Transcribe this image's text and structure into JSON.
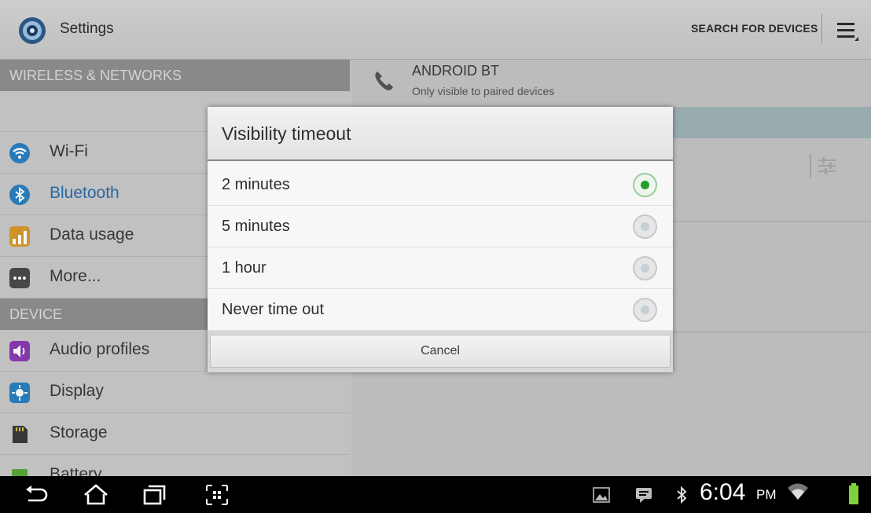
{
  "action_bar": {
    "title": "Settings",
    "search_label": "SEARCH FOR DEVICES",
    "menu_icon": "overflow-menu-icon"
  },
  "left_pane": {
    "section_wireless": "WIRELESS & NETWORKS",
    "section_device": "DEVICE",
    "items": [
      {
        "label": "Wi-Fi",
        "icon": "wifi-icon"
      },
      {
        "label": "Bluetooth",
        "icon": "bluetooth-icon",
        "selected": true
      },
      {
        "label": "Data usage",
        "icon": "data-usage-icon"
      },
      {
        "label": "More...",
        "icon": "more-icon"
      },
      {
        "label": "Audio profiles",
        "icon": "audio-profiles-icon"
      },
      {
        "label": "Display",
        "icon": "display-icon"
      },
      {
        "label": "Storage",
        "icon": "storage-icon"
      },
      {
        "label": "Battery",
        "icon": "battery-icon"
      }
    ]
  },
  "right_pane": {
    "device_name": "ANDROID BT",
    "device_sub": "Only visible to paired devices"
  },
  "dialog": {
    "title": "Visibility timeout",
    "options": [
      {
        "label": "2 minutes",
        "checked": true
      },
      {
        "label": "5 minutes",
        "checked": false
      },
      {
        "label": "1 hour",
        "checked": false
      },
      {
        "label": "Never time out",
        "checked": false
      }
    ],
    "cancel_label": "Cancel"
  },
  "system_bar": {
    "time": "6:04",
    "ampm": "PM"
  },
  "colors": {
    "accent_green": "#21a12b",
    "selected_text": "#2a6ea8",
    "battery_green": "#7fd33a"
  }
}
